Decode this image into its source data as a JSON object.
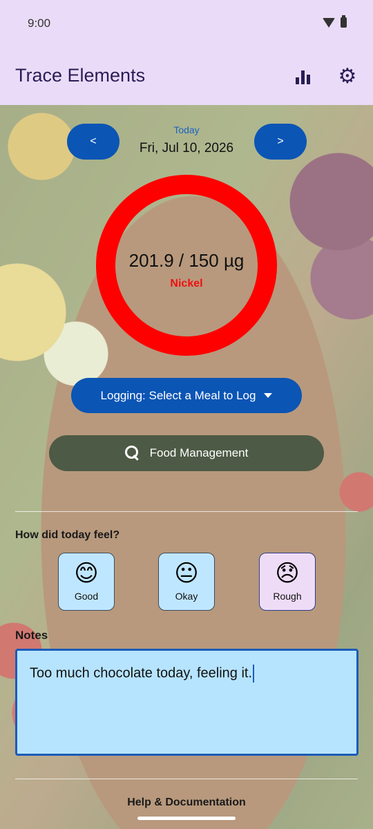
{
  "status_bar": {
    "time": "9:00"
  },
  "app_bar": {
    "title": "Trace Elements",
    "stats_icon": "bar-chart-icon",
    "settings_icon": "gear-icon"
  },
  "date_nav": {
    "prev_label": "<",
    "next_label": ">",
    "today_label": "Today",
    "date": "Fri, Jul 10, 2026"
  },
  "gauge": {
    "value_text": "201.9 / 150 µg",
    "element": "Nickel",
    "consumed": 201.9,
    "limit": 150,
    "ring_color": "#ff0000",
    "element_color": "#ee1111"
  },
  "logging_button": {
    "label": "Logging: Select a Meal to Log",
    "icon": "caret-down-icon"
  },
  "food_button": {
    "label": "Food Management",
    "icon": "search-icon"
  },
  "mood": {
    "question": "How did today feel?",
    "options": [
      {
        "emoji": "😊",
        "label": "Good"
      },
      {
        "emoji": "😐",
        "label": "Okay"
      },
      {
        "emoji": "😞",
        "label": "Rough"
      }
    ],
    "selected": "Rough"
  },
  "notes": {
    "label": "Notes",
    "value": "Too much chocolate today, feeling it."
  },
  "footer": {
    "help_label": "Help & Documentation"
  },
  "colors": {
    "primary": "#0b55b5",
    "app_bar_bg": "#eadcf8",
    "food_button_bg": "#4d5a45"
  }
}
